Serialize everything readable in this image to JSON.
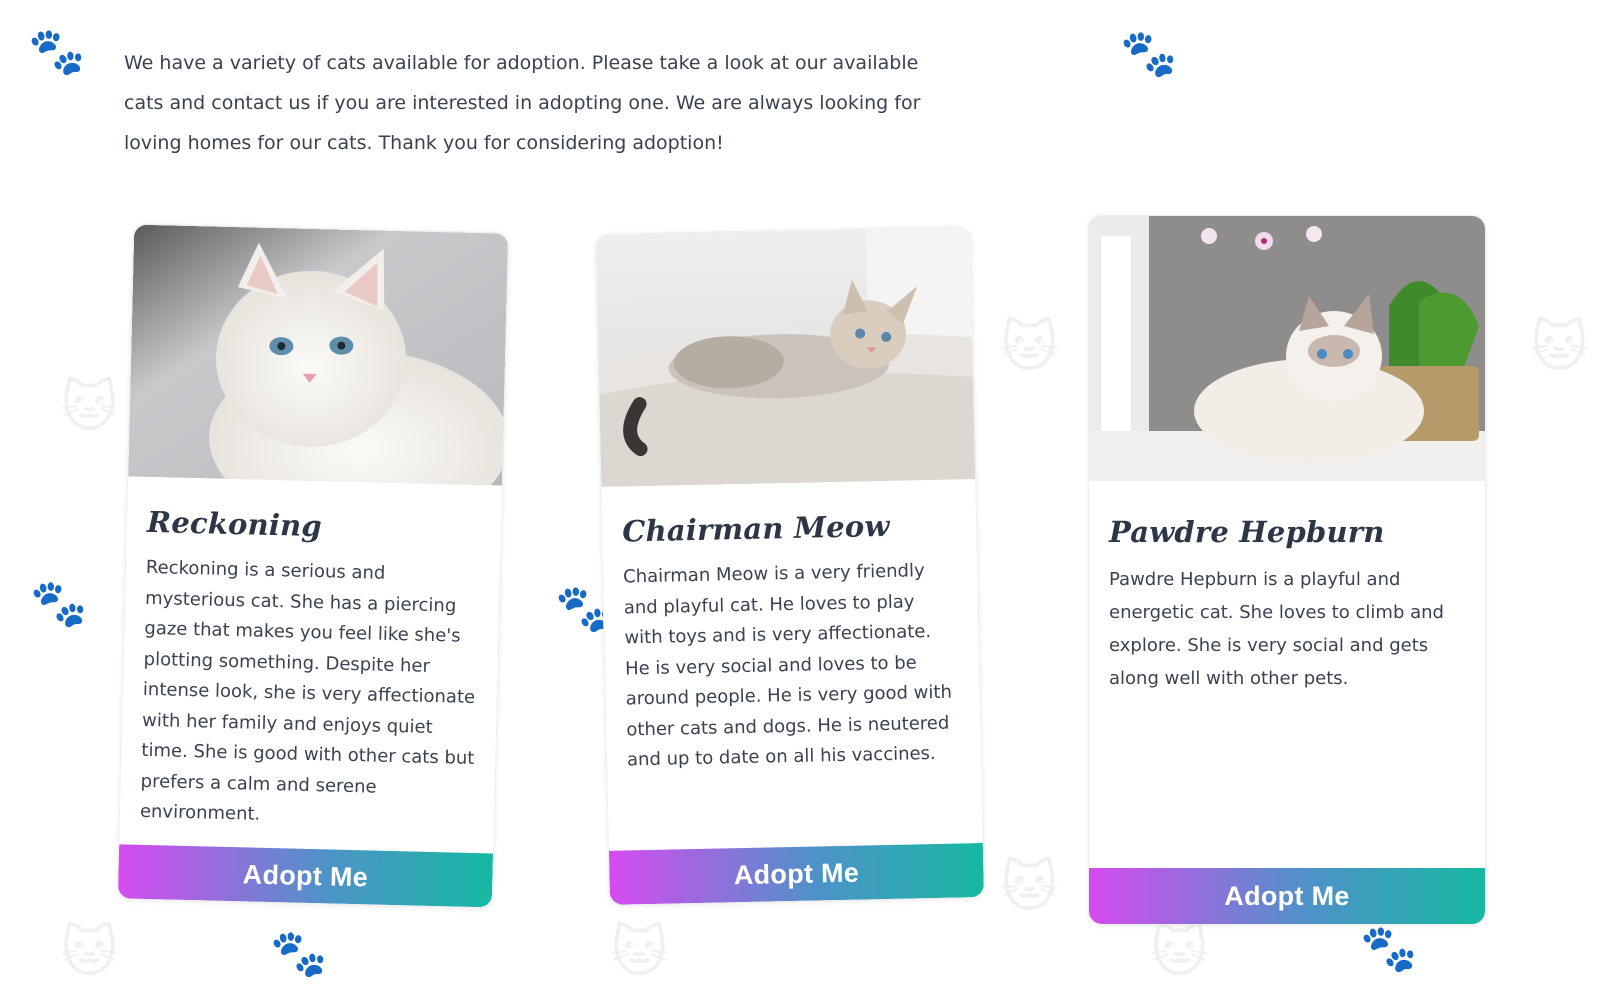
{
  "intro": {
    "text": "We have a variety of cats available for adoption. Please take a look at our available cats and contact us if you are interested in adopting one. We are always looking for loving homes for our cats. Thank you for considering adoption!"
  },
  "cats": [
    {
      "name": "Reckoning",
      "description": "Reckoning is a serious and mysterious cat. She has a piercing gaze that makes you feel like she's plotting something. Despite her intense look, she is very affectionate with her family and enjoys quiet time. She is good with other cats but prefers a calm and serene environment.",
      "button_label": "Adopt Me"
    },
    {
      "name": "Chairman Meow",
      "description": "Chairman Meow is a very friendly and playful cat. He loves to play with toys and is very affectionate. He is very social and loves to be around people. He is very good with other cats and dogs. He is neutered and up to date on all his vaccines.",
      "button_label": "Adopt Me"
    },
    {
      "name": "Pawdre Hepburn",
      "description": "Pawdre Hepburn is a playful and energetic cat. She loves to climb and explore. She is very social and gets along well with other pets.",
      "button_label": "Adopt Me"
    }
  ],
  "colors": {
    "button_gradient_start": "#d64bef",
    "button_gradient_mid": "#4f92c8",
    "button_gradient_end": "#17b8a2",
    "text": "#3a4150",
    "heading": "#2c3646"
  },
  "icons": [
    "paw-print-icon",
    "cat-face-icon"
  ]
}
